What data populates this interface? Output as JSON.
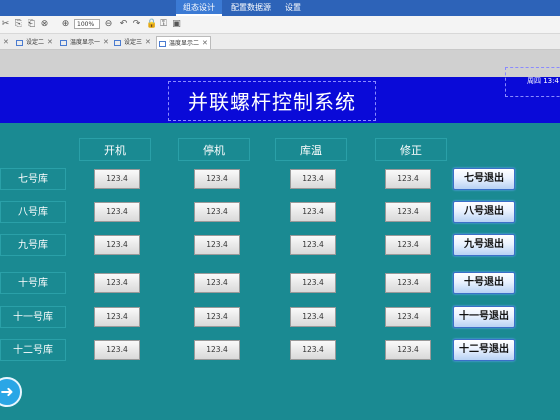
{
  "menu": {
    "items": [
      "组态设计",
      "配置数据源",
      "设置"
    ],
    "active_index": 0
  },
  "toolbar": {
    "zoom": "100%"
  },
  "tabs": [
    "设定二",
    "温度显示一",
    "设定三",
    "温度显示二"
  ],
  "screen": {
    "title": "并联螺杆控制系统",
    "time": "周四 13:4",
    "columns": [
      "开机",
      "停机",
      "库温",
      "修正"
    ],
    "rows": [
      {
        "label": "七号库",
        "values": [
          "123.4",
          "123.4",
          "123.4",
          "123.4"
        ],
        "exit": "七号退出"
      },
      {
        "label": "八号库",
        "values": [
          "123.4",
          "123.4",
          "123.4",
          "123.4"
        ],
        "exit": "八号退出"
      },
      {
        "label": "九号库",
        "values": [
          "123.4",
          "123.4",
          "123.4",
          "123.4"
        ],
        "exit": "九号退出"
      },
      {
        "label": "十号库",
        "values": [
          "123.4",
          "123.4",
          "123.4",
          "123.4"
        ],
        "exit": "十号退出"
      },
      {
        "label": "十一号库",
        "values": [
          "123.4",
          "123.4",
          "123.4",
          "123.4"
        ],
        "exit": "十一号退出"
      },
      {
        "label": "十二号库",
        "values": [
          "123.4",
          "123.4",
          "123.4",
          "123.4"
        ],
        "exit": "十二号退出"
      }
    ]
  }
}
